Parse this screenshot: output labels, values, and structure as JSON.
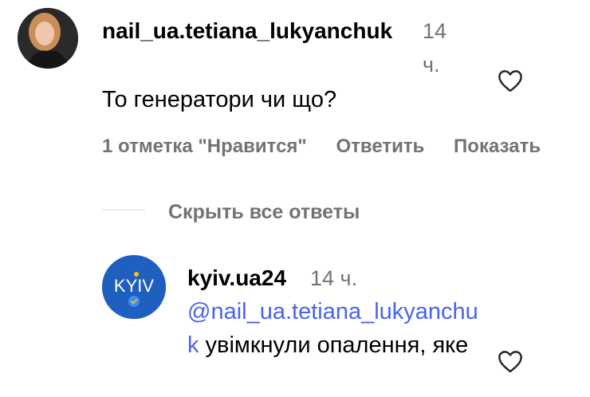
{
  "comment": {
    "username": "nail_ua.tetiana_lukyanchuk",
    "time": "14 ч.",
    "text": "То генератори чи що?",
    "likes_label": "1 отметка \"Нравится\"",
    "reply_label": "Ответить",
    "show_label": "Показать"
  },
  "replies_toggle": {
    "label": "Скрыть все ответы"
  },
  "reply": {
    "username": "kyiv.ua24",
    "time": "14 ч.",
    "avatar_text": "KYIV",
    "mention": "@nail_ua.tetiana_lukyanchuk",
    "text": " увімкнули опалення, яке"
  },
  "icons": {
    "like": "heart-outline-icon",
    "verified": "verified-badge-icon"
  },
  "colors": {
    "secondary_text": "#737373",
    "mention": "#4a63f0",
    "kyiv_avatar_bg": "#1f5fbf",
    "verified_badge": "#f5c518"
  }
}
